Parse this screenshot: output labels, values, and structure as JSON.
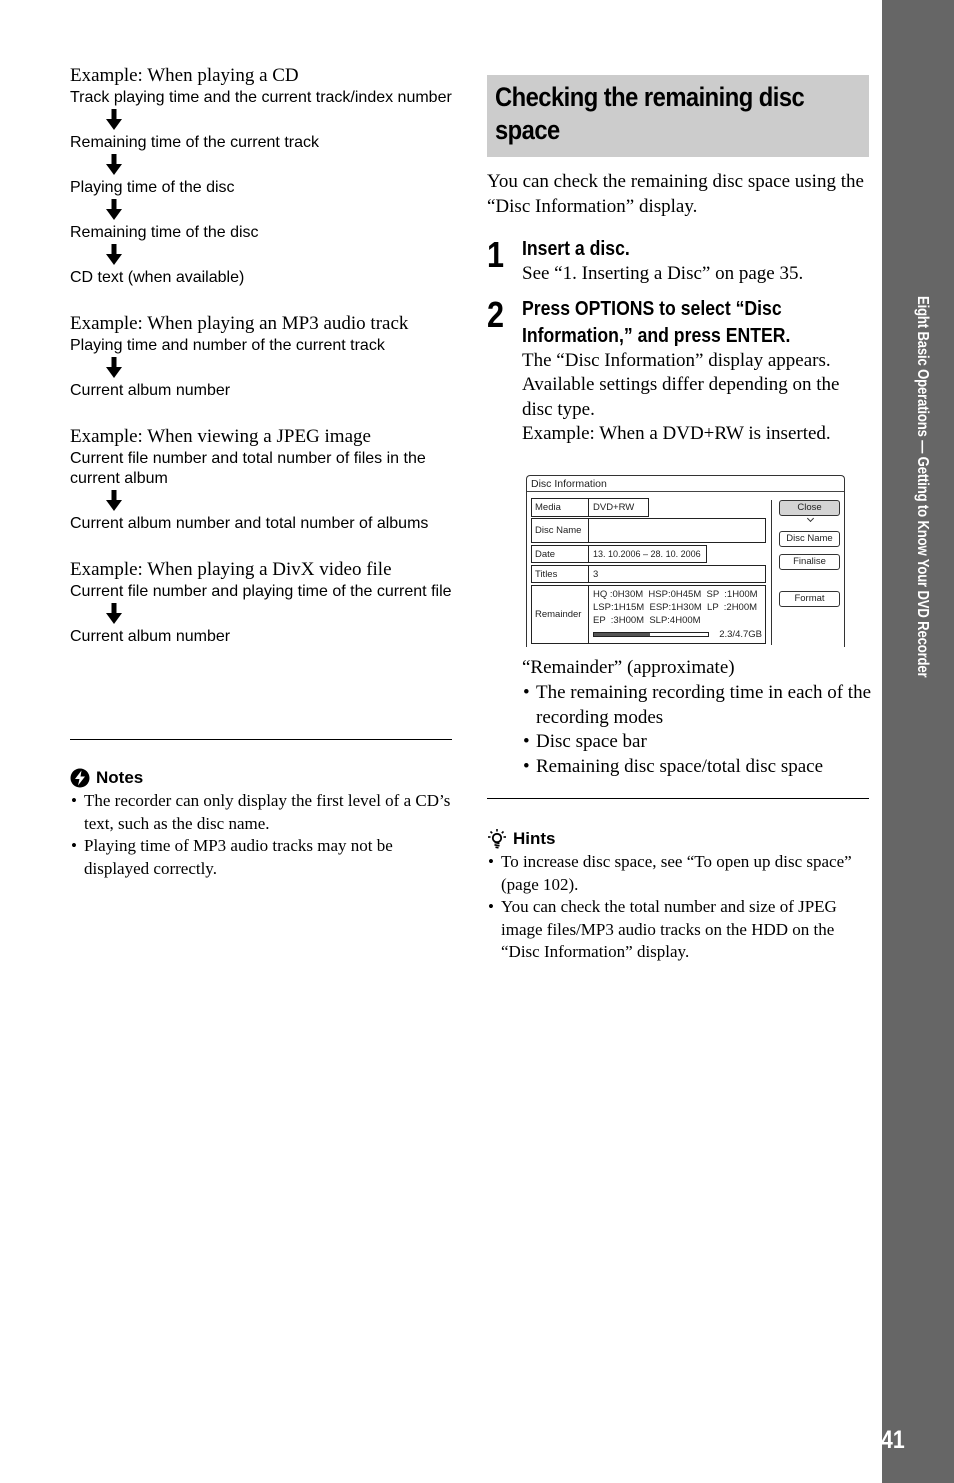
{
  "left": {
    "examples": [
      {
        "title": "Example: When playing a CD",
        "items": [
          "Track playing time and the current track/index number",
          "Remaining time of the current track",
          "Playing time of the disc",
          "Remaining time of the disc",
          "CD text (when available)"
        ]
      },
      {
        "title": "Example: When playing an MP3 audio track",
        "items": [
          "Playing time and number of the current track",
          "Current album number"
        ]
      },
      {
        "title": "Example: When viewing a JPEG image",
        "items": [
          "Current file number and total number of files in the current album",
          "Current album number and total number of albums"
        ]
      },
      {
        "title": "Example: When playing a DivX video file",
        "items": [
          "Current file number and playing time of the current file",
          "Current album number"
        ]
      }
    ],
    "notes": {
      "icon": "notes-warning-icon",
      "label": "Notes",
      "items": [
        "The recorder can only display the first level of a CD’s text, such as the disc name.",
        "Playing time of MP3 audio tracks may not be displayed correctly."
      ]
    }
  },
  "right": {
    "heading": "Checking the remaining disc space",
    "intro": "You can check the remaining disc space using the “Disc Information” display.",
    "steps": [
      {
        "number": "1",
        "title": "Insert a disc.",
        "body": [
          "See “1. Inserting a Disc” on page 35."
        ]
      },
      {
        "number": "2",
        "title": "Press OPTIONS to select “Disc Information,” and press ENTER.",
        "body": [
          "The “Disc Information” display appears.",
          "Available settings differ depending on the disc type.",
          "Example: When a DVD+RW is inserted."
        ]
      }
    ],
    "disc_info": {
      "title": "Disc Information",
      "rows": {
        "media": {
          "label": "Media",
          "value": "DVD+RW"
        },
        "disc_name": {
          "label": "Disc Name",
          "value": ""
        },
        "date": {
          "label": "Date",
          "value": "13. 10.2006 – 28. 10. 2006"
        },
        "titles": {
          "label": "Titles",
          "value": "3"
        },
        "remainder": {
          "label": "Remainder",
          "lines": [
            "HQ :0H30M  HSP:0H45M  SP  :1H00M",
            "LSP:1H15M  ESP:1H30M  LP  :2H00M",
            "EP  :3H00M  SLP:4H00M"
          ],
          "used_fraction": 0.49,
          "space_text": "2.3/4.7GB"
        }
      },
      "buttons": {
        "close": "Close",
        "disc_name": "Disc Name",
        "finalise": "Finalise",
        "format": "Format"
      }
    },
    "remainder_notes": {
      "title": "“Remainder” (approximate)",
      "items": [
        "The remaining recording time in each of the recording modes",
        "Disc space bar",
        "Remaining disc space/total disc space"
      ]
    },
    "hints": {
      "icon": "lightbulb-hint-icon",
      "label": "Hints",
      "items": [
        "To increase disc space, see “To open up disc space” (page 102).",
        "You can check the total number and size of JPEG image files/MP3 audio tracks on the HDD on the “Disc Information” display."
      ]
    }
  },
  "side_tab": {
    "text": "Eight Basic Operations — Getting to Know Your DVD Recorder",
    "color": "#666666"
  },
  "page_number": "41"
}
